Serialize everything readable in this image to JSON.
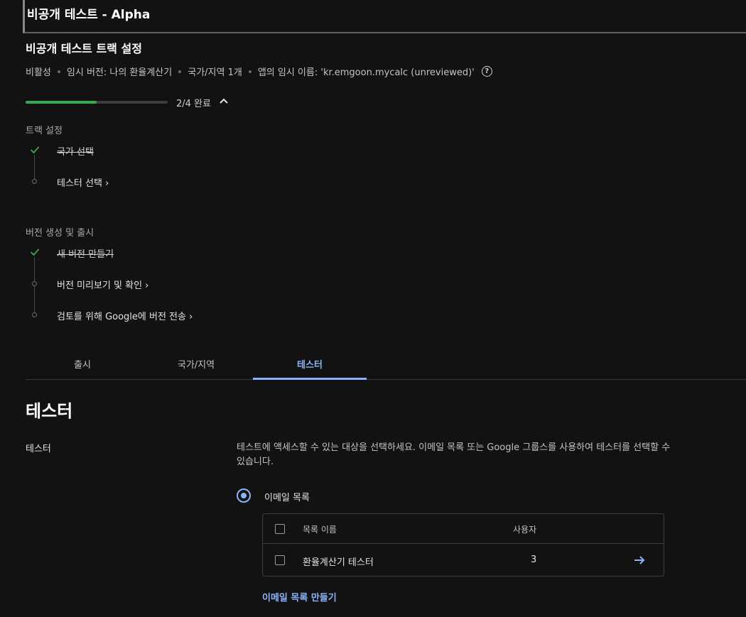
{
  "app_title": "비공개 테스트 - Alpha",
  "section_title": "비공개 테스트 트랙 설정",
  "meta": {
    "status": "비활성",
    "temp_version": "임시 버전: 나의 환율계산기",
    "countries": "국가/지역 1개",
    "temp_app_name": "앱의 임시 이름: 'kr.emgoon.mycalc (unreviewed)'"
  },
  "progress": {
    "label": "2/4 완료",
    "fraction": 0.5
  },
  "groups": [
    {
      "label": "트랙 설정",
      "steps": [
        {
          "label": "국가 선택",
          "done": true
        },
        {
          "label": "테스터 선택 ›",
          "done": false
        }
      ]
    },
    {
      "label": "버전 생성 및 출시",
      "steps": [
        {
          "label": "새 버전 만들기",
          "done": true
        },
        {
          "label": "버전 미리보기 및 확인 ›",
          "done": false
        },
        {
          "label": "검토를 위해 Google에 버전 전송 ›",
          "done": false
        }
      ]
    }
  ],
  "tabs": [
    {
      "label": "출시"
    },
    {
      "label": "국가/지역"
    },
    {
      "label": "테스터",
      "active": true
    }
  ],
  "testers": {
    "heading": "테스터",
    "field_label": "테스터",
    "description": "테스트에 액세스할 수 있는 대상을 선택하세요. 이메일 목록 또는 Google 그룹스를 사용하여 테스터를 선택할 수 있습니다.",
    "radio_label": "이메일 목록",
    "table": {
      "col_name": "목록 이름",
      "col_users": "사용자",
      "rows": [
        {
          "name": "환율계산기 테스터",
          "users": "3"
        }
      ]
    },
    "create_link": "이메일 목록 만들기"
  },
  "colors": {
    "accent": "#8ab4f8",
    "progress": "#34a853",
    "check": "#34a853"
  },
  "icons": {
    "help": "help-circle-icon",
    "collapse": "chevron-up-icon",
    "done": "check-icon",
    "row_action": "arrow-right-icon"
  }
}
